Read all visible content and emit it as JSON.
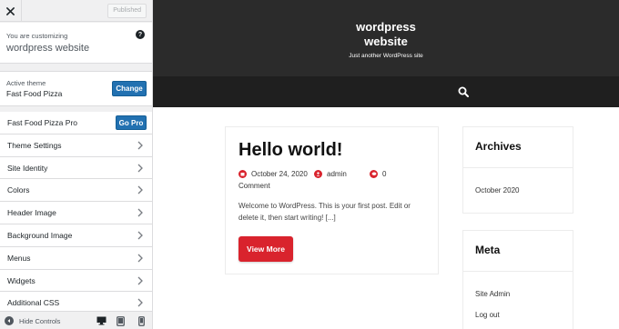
{
  "customizer": {
    "close_icon": "close-icon",
    "published_label": "Published",
    "info_prefix": "You are customizing",
    "site_name": "wordpress website",
    "help_icon": "help-icon",
    "active_theme_label": "Active theme",
    "active_theme_name": "Fast Food Pizza",
    "change_label": "Change",
    "pro_row_label": "Fast Food Pizza Pro",
    "go_pro_label": "Go Pro",
    "sections": [
      "Theme Settings",
      "Site Identity",
      "Colors",
      "Header Image",
      "Background Image",
      "Menus",
      "Widgets",
      "Additional CSS"
    ],
    "hide_controls_label": "Hide Controls",
    "device_icons": [
      "desktop-icon",
      "tablet-icon",
      "mobile-icon"
    ],
    "accent": "#2271b1"
  },
  "site": {
    "title_line1": "wordpress",
    "title_line2": "website",
    "tagline": "Just another WordPress site",
    "header_color": "#2b2b2b",
    "nav_color": "#1f1f1f",
    "search_icon": "search-icon"
  },
  "post": {
    "title": "Hello world!",
    "date": "October 24, 2020",
    "author": "admin",
    "comments_count": "0",
    "comments_label": "Comment",
    "excerpt": "Welcome to WordPress. This is your first post. Edit or delete it, then start writing! [...]",
    "view_more_label": "View More",
    "accent": "#d9232d"
  },
  "sidebar_widgets": {
    "archives_title": "Archives",
    "archives_items": [
      "October 2020"
    ],
    "meta_title": "Meta",
    "meta_items": [
      "Site Admin",
      "Log out"
    ]
  }
}
